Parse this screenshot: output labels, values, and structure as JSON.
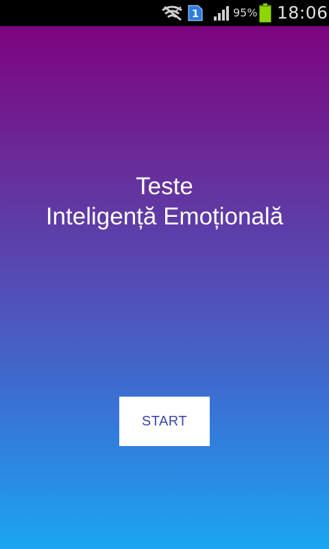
{
  "status_bar": {
    "icons": {
      "wifi": "wifi-off-icon",
      "sim": "sim-1-icon",
      "signal": "signal-icon",
      "battery": "battery-icon"
    },
    "sim_label": "1",
    "battery_percent": "95%",
    "battery_level": 0.95,
    "time": "18:06"
  },
  "main": {
    "title_line1": "Teste",
    "title_line2": "Inteligență Emoțională",
    "start_label": "START"
  },
  "colors": {
    "gradient_top": "#7d047f",
    "gradient_bottom": "#1ba6f2",
    "button_text": "#3a44a8",
    "battery_green": "#8dd400",
    "sim_blue": "#2b7de0"
  }
}
